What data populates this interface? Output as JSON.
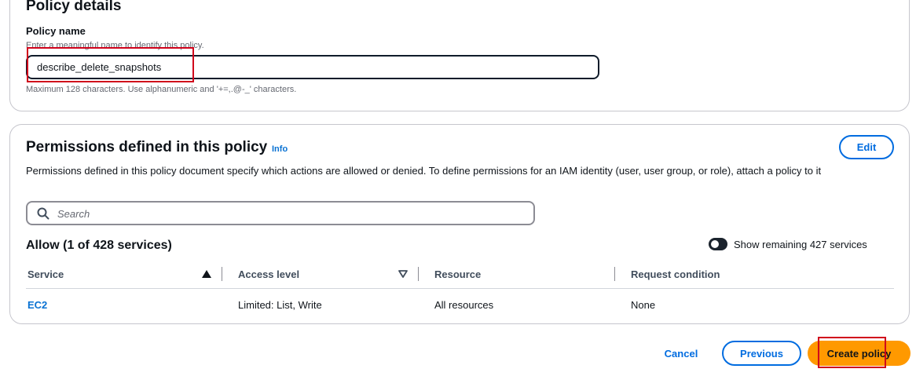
{
  "policy_details": {
    "title": "Policy details",
    "name_label": "Policy name",
    "name_hint": "Enter a meaningful name to identify this policy.",
    "name_value": "describe_delete_snapshots",
    "name_constraint": "Maximum 128 characters. Use alphanumeric and '+=,.@-_' characters."
  },
  "permissions": {
    "title": "Permissions defined in this policy",
    "info_label": "Info",
    "edit_label": "Edit",
    "description": "Permissions defined in this policy document specify which actions are allowed or denied. To define permissions for an IAM identity (user, user group, or role), attach a policy to it",
    "search_placeholder": "Search",
    "allow_title": "Allow (1 of 428 services)",
    "toggle_label": "Show remaining 427 services",
    "toggle_on": false,
    "columns": [
      "Service",
      "Access level",
      "Resource",
      "Request condition"
    ],
    "rows": [
      {
        "service": "EC2",
        "access_level": "Limited: List, Write",
        "resource": "All resources",
        "condition": "None"
      }
    ]
  },
  "footer": {
    "cancel_label": "Cancel",
    "previous_label": "Previous",
    "create_label": "Create policy"
  },
  "colors": {
    "link": "#0972d3",
    "primary_button": "#ff9900",
    "annotation": "#d0021b"
  }
}
